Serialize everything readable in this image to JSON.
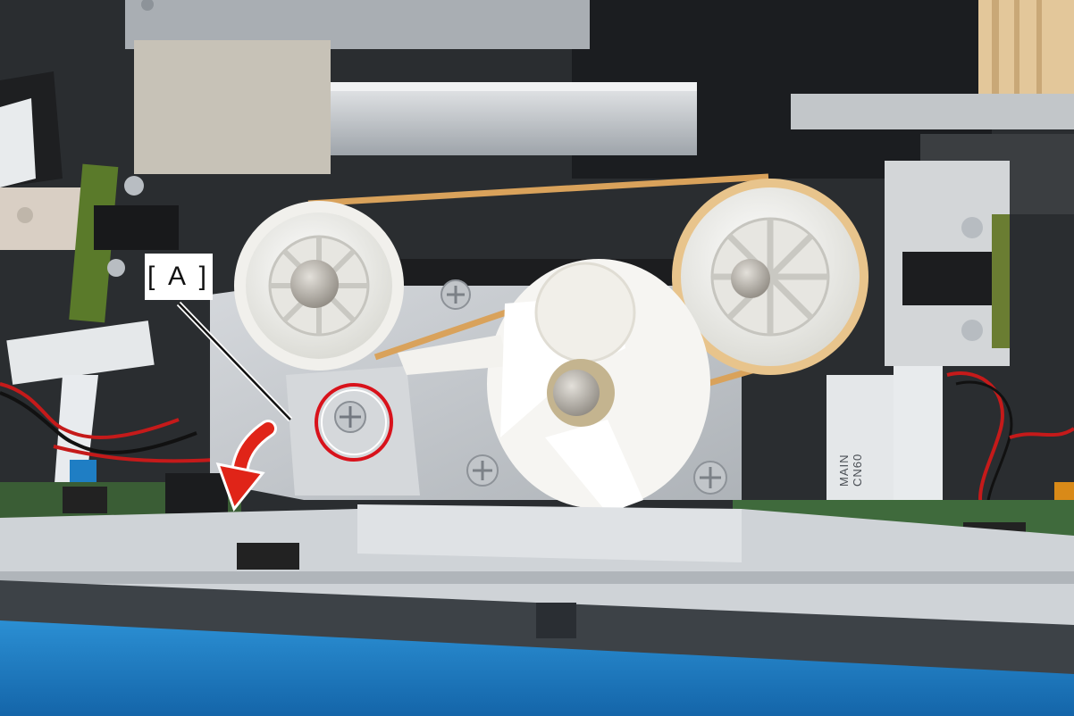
{
  "callout": {
    "label": "[ A ]"
  },
  "cable": {
    "line1": "MAIN",
    "line2": "CN60"
  },
  "colors": {
    "highlight_circle": "#d8121b",
    "arrow": "#e02418",
    "base_blue": "#1f7ec4",
    "chassis": "#c9ced3",
    "pulley_white": "#f4f4f1",
    "belt": "#d9a25b"
  }
}
